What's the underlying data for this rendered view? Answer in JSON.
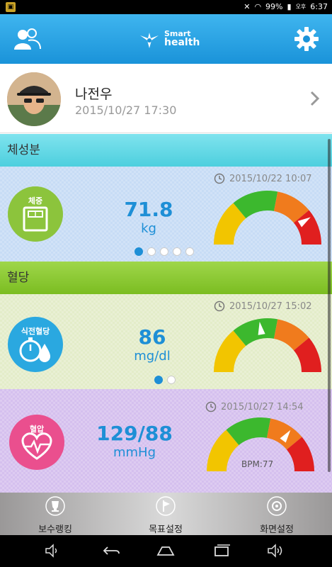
{
  "status_bar": {
    "battery": "99%",
    "ampm": "오후",
    "time": "6:37"
  },
  "app_bar": {
    "logo_line1": "Smart",
    "logo_line2": "health",
    "icons": [
      "friends-icon",
      "gear-icon"
    ]
  },
  "profile": {
    "name": "나전우",
    "timestamp": "2015/10/27 17:30"
  },
  "sections": {
    "body_composition": "체성분",
    "glucose": "혈당"
  },
  "weight_card": {
    "badge": "체중",
    "value": "71.8",
    "unit": "kg",
    "timestamp": "2015/10/22 10:07",
    "gauge_level": 0.82,
    "pages": 5,
    "active_page": 0
  },
  "sugar_card": {
    "badge": "식전혈당",
    "value": "86",
    "unit": "mg/dl",
    "timestamp": "2015/10/27 15:02",
    "gauge_level": 0.45,
    "pages": 2,
    "active_page": 0
  },
  "bp_card": {
    "badge": "혈압",
    "value": "129/88",
    "unit": "mmHg",
    "timestamp": "2015/10/27 14:54",
    "bpm": "BPM:77",
    "gauge_level": 0.7
  },
  "bottom_nav": {
    "ranking": "보수랭킹",
    "goal": "목표설정",
    "screen": "화면설정"
  },
  "colors": {
    "app_bar": "#1a93d9",
    "accent_value": "#1e8fd6",
    "gauge_yellow": "#f2c500",
    "gauge_green": "#3cb82e",
    "gauge_orange": "#f07b1d",
    "gauge_red": "#e01f1f"
  }
}
